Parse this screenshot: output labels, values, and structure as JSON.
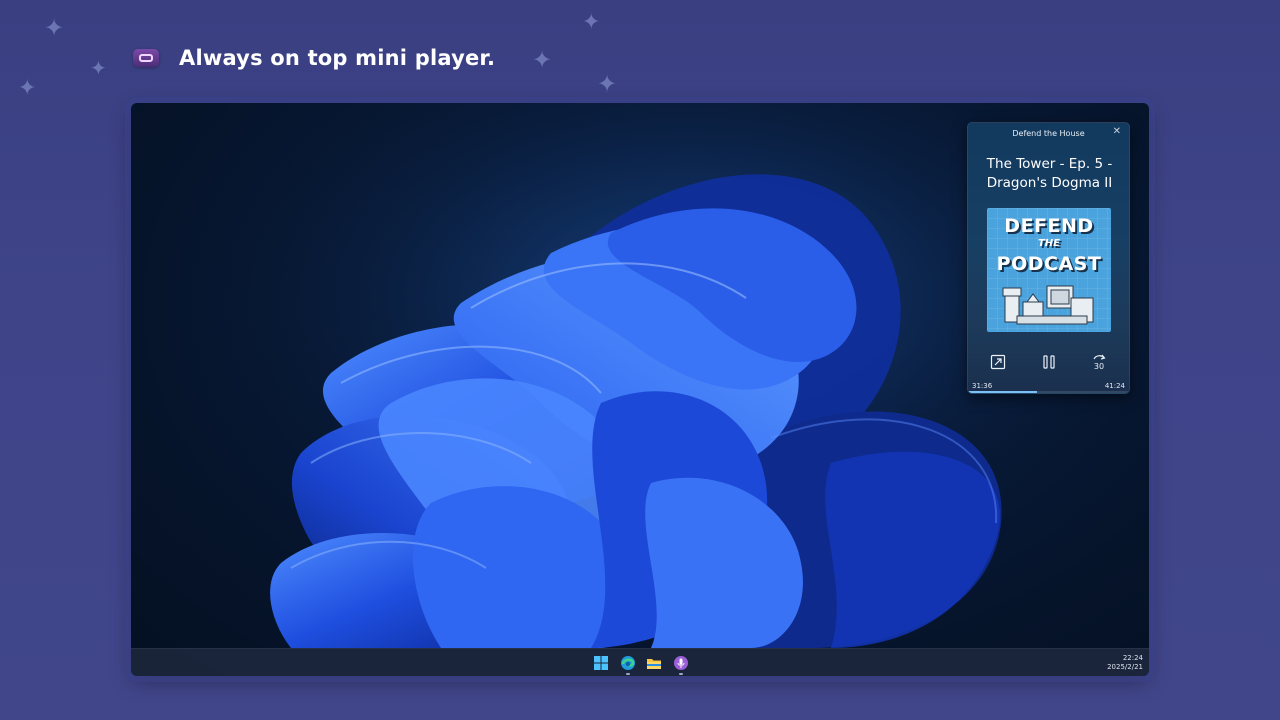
{
  "header": {
    "title": "Always on top mini player.",
    "icon": "player-app-icon"
  },
  "mini_player": {
    "show_title": "Defend the House",
    "episode_title": "The Tower - Ep. 5 - Dragon's Dogma II",
    "artwork": {
      "line1": "DEFEND",
      "line2": "THE",
      "line3": "PODCAST"
    },
    "elapsed": "31:36",
    "total": "41:24",
    "progress": 0.43,
    "skip_seconds": "30",
    "controls": [
      "expand-icon",
      "pause-icon",
      "skip-forward-30-icon"
    ]
  },
  "taskbar": {
    "time": "22:24",
    "date": "2025/2/21",
    "apps": [
      "windows-start-icon",
      "edge-icon",
      "file-explorer-icon",
      "podcast-app-icon"
    ]
  },
  "colors": {
    "background": "#3f4489",
    "accent": "#7dc0f5",
    "wallpaper_blue": "#1f4fe0"
  }
}
